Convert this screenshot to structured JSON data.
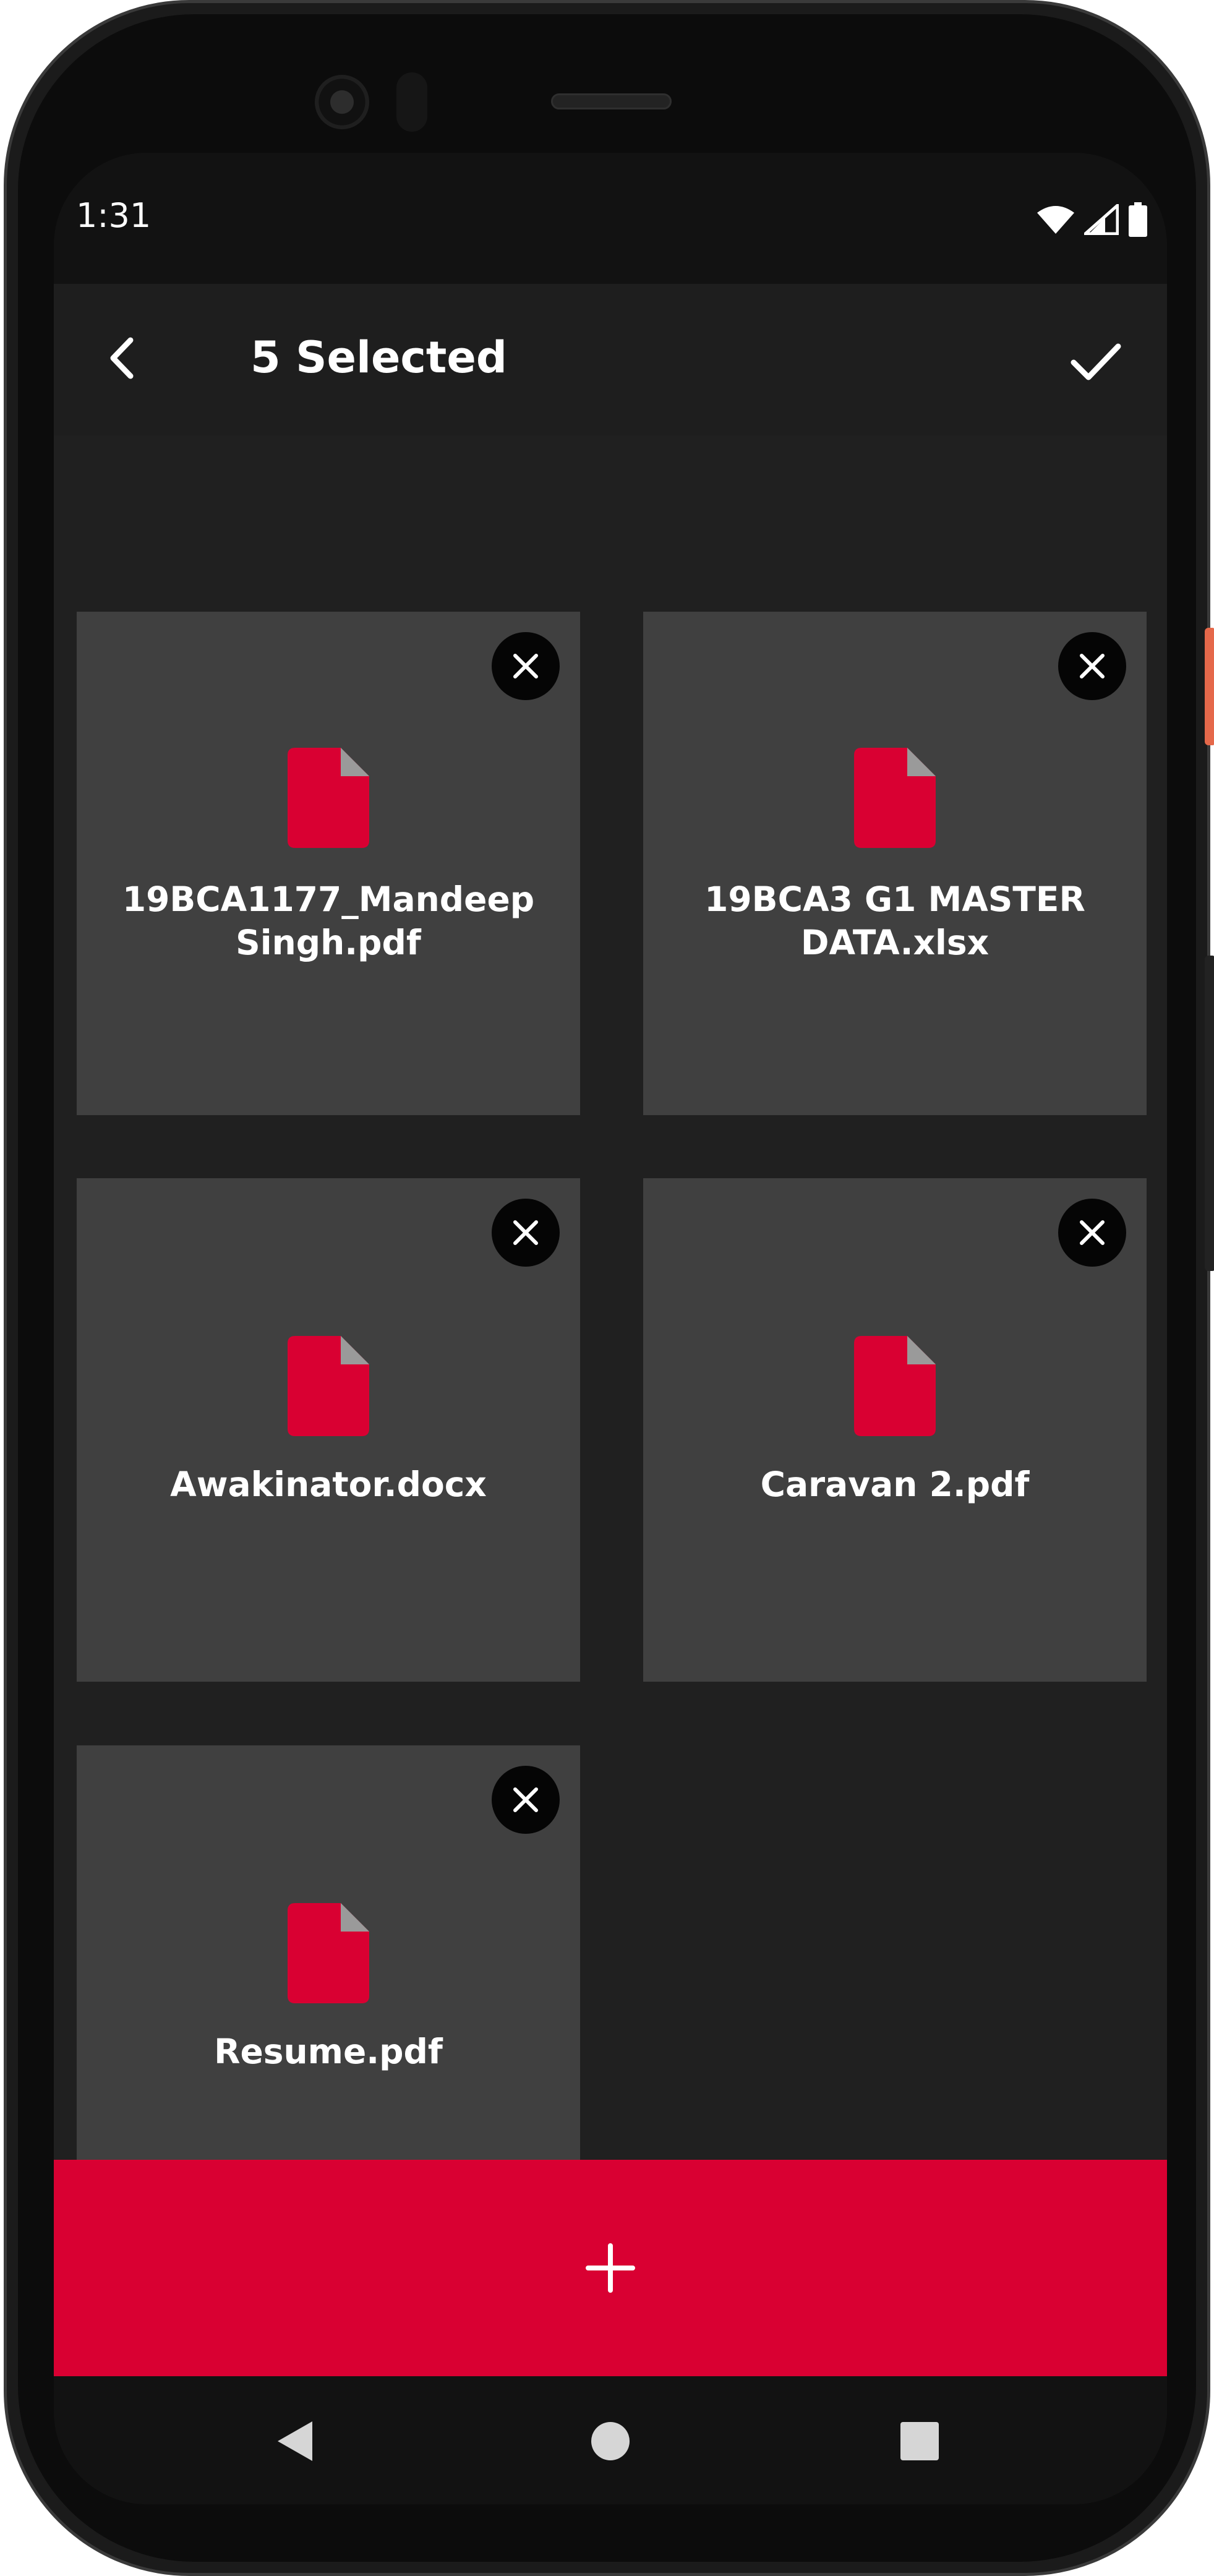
{
  "status_bar": {
    "time": "1:31",
    "icons": [
      "wifi-icon",
      "cellular-signal-icon",
      "battery-icon"
    ]
  },
  "app_bar": {
    "title": "5 Selected",
    "back_icon": "chevron-left-icon",
    "done_icon": "check-icon"
  },
  "files": [
    {
      "name": "19BCA1177_Mandeep Singh.pdf",
      "line1": "19BCA1177_Mandeep",
      "line2": "Singh.pdf",
      "icon": "document-icon"
    },
    {
      "name": "19BCA3 G1 MASTER DATA.xlsx",
      "line1": "19BCA3 G1 MASTER",
      "line2": "DATA.xlsx",
      "icon": "document-icon"
    },
    {
      "name": "Awakinator.docx",
      "line1": "Awakinator.docx",
      "icon": "document-icon"
    },
    {
      "name": "Caravan 2.pdf",
      "line1": "Caravan 2.pdf",
      "icon": "document-icon"
    },
    {
      "name": "Resume.pdf",
      "line1": "Resume.pdf",
      "icon": "document-icon"
    }
  ],
  "add_button": {
    "icon": "plus-icon"
  },
  "nav": {
    "back": "triangle-back-icon",
    "home": "circle-home-icon",
    "recents": "square-recents-icon"
  },
  "colors": {
    "accent": "#d90032",
    "tile": "#404040",
    "background": "#202020",
    "app_bar": "#1e1e1e"
  }
}
